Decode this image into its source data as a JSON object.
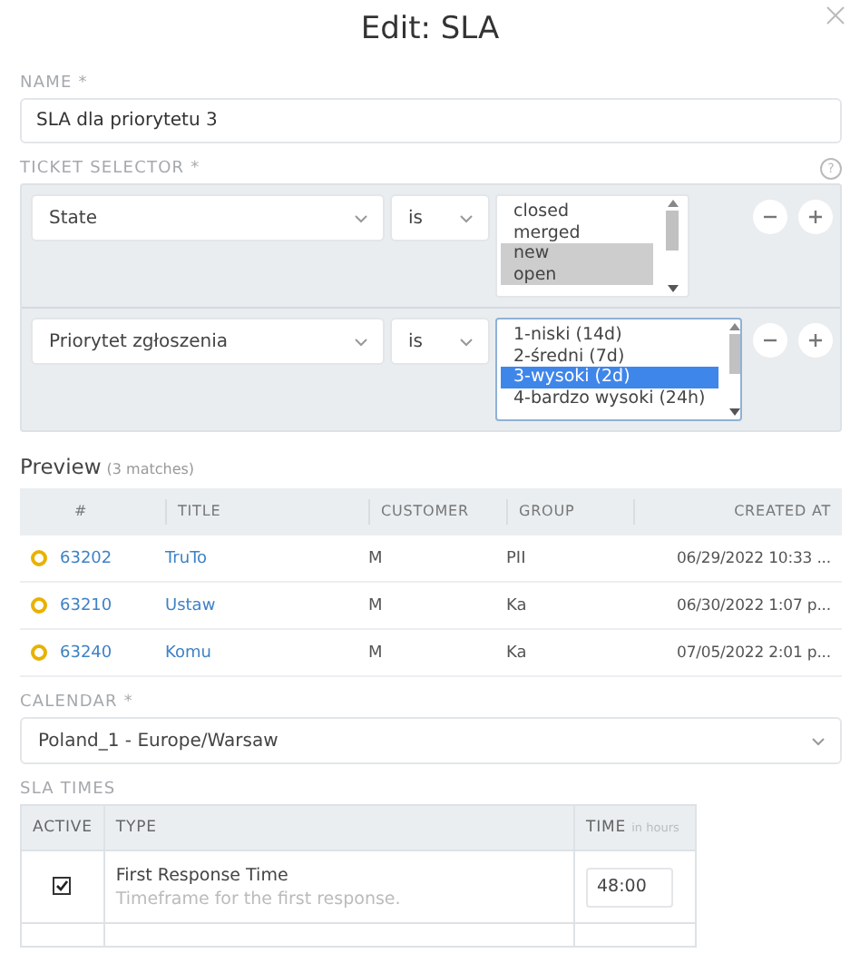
{
  "dialog": {
    "title": "Edit: SLA"
  },
  "name_field": {
    "label": "NAME *",
    "value": "SLA dla priorytetu 3"
  },
  "ticket_selector": {
    "label": "TICKET SELECTOR *",
    "help": "?",
    "conditions": [
      {
        "attribute": "State",
        "operator": "is",
        "focused": false,
        "options": [
          {
            "label": "closed",
            "selected": false
          },
          {
            "label": "merged",
            "selected": false
          },
          {
            "label": "new",
            "selected": true
          },
          {
            "label": "open",
            "selected": true
          }
        ]
      },
      {
        "attribute": "Priorytet zgłoszenia",
        "operator": "is",
        "focused": true,
        "options": [
          {
            "label": "1-niski (14d)",
            "selected": false
          },
          {
            "label": "2-średni (7d)",
            "selected": false
          },
          {
            "label": "3-wysoki (2d)",
            "selected": true
          },
          {
            "label": "4-bardzo wysoki (24h)",
            "selected": false
          }
        ]
      }
    ]
  },
  "preview": {
    "title": "Preview",
    "count": "(3 matches)",
    "columns": [
      "#",
      "TITLE",
      "CUSTOMER",
      "GROUP",
      "CREATED AT"
    ],
    "rows": [
      {
        "color": "#e8b200",
        "number": "63202",
        "title": "TruTo",
        "customer": "M",
        "group": "PII",
        "created_at": "06/29/2022 10:33 ..."
      },
      {
        "color": "#e8b200",
        "number": "63210",
        "title": "Ustaw",
        "customer": "M",
        "group": "Ka",
        "created_at": "06/30/2022 1:07 p..."
      },
      {
        "color": "#e8b200",
        "number": "63240",
        "title": "Komu",
        "customer": "M",
        "group": "Ka",
        "created_at": "07/05/2022 2:01 p..."
      }
    ]
  },
  "calendar": {
    "label": "CALENDAR *",
    "value": "Poland_1 - Europe/Warsaw"
  },
  "sla_times": {
    "label": "SLA TIMES",
    "columns": {
      "active": "ACTIVE",
      "type": "TYPE",
      "time": "TIME",
      "time_hint": "in hours"
    },
    "rows": [
      {
        "active": true,
        "name": "First Response Time",
        "description": "Timeframe for the first response.",
        "time": "48:00"
      }
    ]
  }
}
